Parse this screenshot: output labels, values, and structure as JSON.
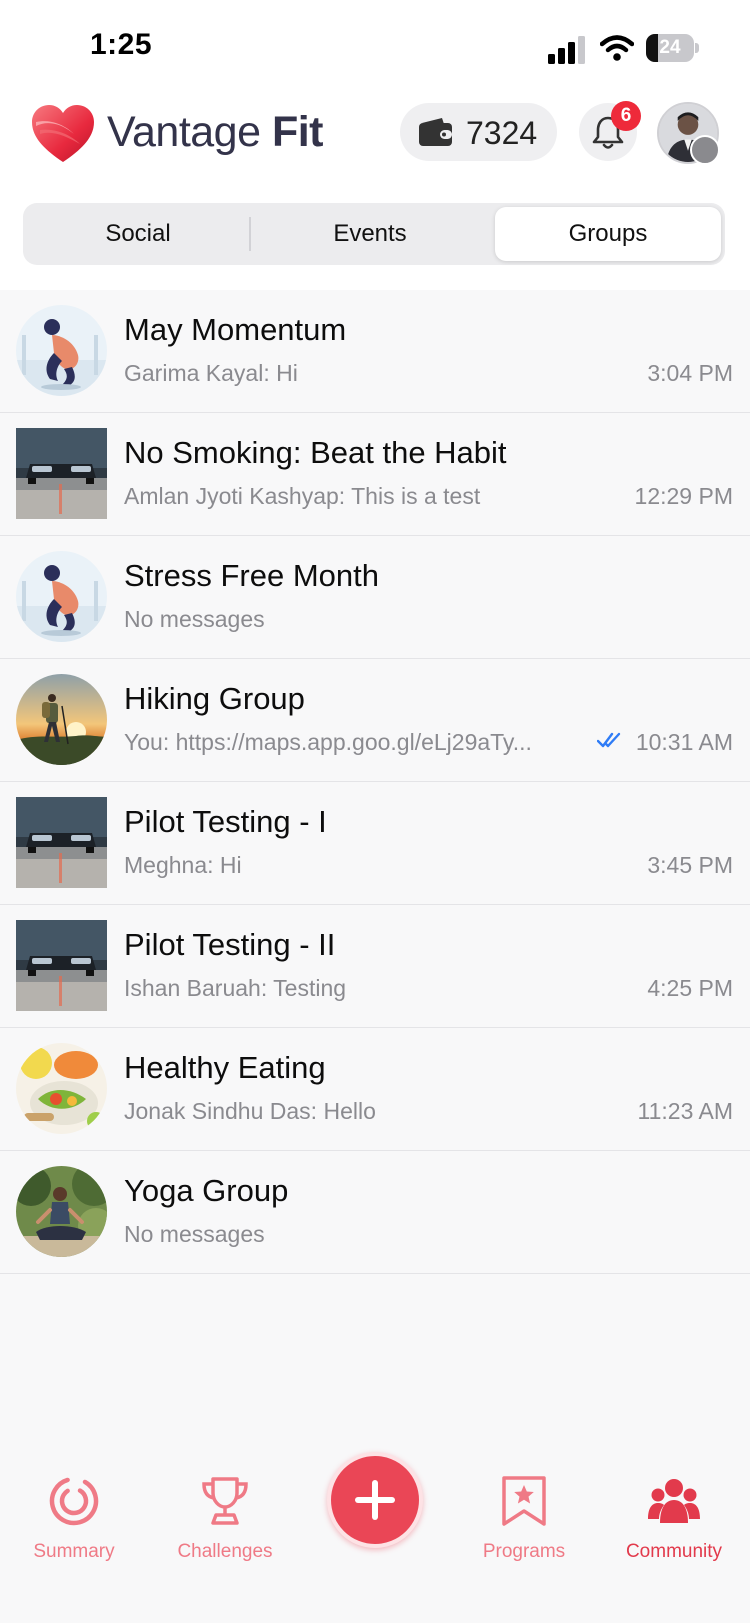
{
  "status_bar": {
    "time": "1:25",
    "battery": "24",
    "battery_level": 0.24
  },
  "header": {
    "brand_regular": "Vantage ",
    "brand_bold": "Fit",
    "wallet_points": "7324",
    "notification_count": "6"
  },
  "tabs": {
    "social": "Social",
    "events": "Events",
    "groups": "Groups",
    "selected": "Groups"
  },
  "groups": [
    {
      "title": "May Momentum",
      "last_message": "Garima Kayal: Hi",
      "time": "3:04 PM",
      "image": "runner-stretch",
      "read_receipt": false
    },
    {
      "title": "No Smoking: Beat the Habit",
      "last_message": "Amlan Jyoti Kashyap: This is a test",
      "time": "12:29 PM",
      "image": "car-tail",
      "read_receipt": false
    },
    {
      "title": "Stress Free Month",
      "last_message": "No messages",
      "time": "",
      "image": "runner-stretch",
      "read_receipt": false
    },
    {
      "title": "Hiking Group",
      "last_message": "You: https://maps.app.goo.gl/eLj29aTy...",
      "time": "10:31 AM",
      "image": "hiker-sunset",
      "read_receipt": true
    },
    {
      "title": "Pilot Testing - I",
      "last_message": "Meghna: Hi",
      "time": "3:45 PM",
      "image": "car-tail",
      "read_receipt": false
    },
    {
      "title": "Pilot Testing - II",
      "last_message": "Ishan Baruah: Testing",
      "time": "4:25 PM",
      "image": "car-tail",
      "read_receipt": false
    },
    {
      "title": "Healthy Eating",
      "last_message": "Jonak Sindhu Das: Hello",
      "time": "11:23 AM",
      "image": "healthy-food",
      "read_receipt": false
    },
    {
      "title": "Yoga Group",
      "last_message": "No messages",
      "time": "",
      "image": "yoga-pose",
      "read_receipt": false
    }
  ],
  "bottom_nav": {
    "summary": "Summary",
    "challenges": "Challenges",
    "programs": "Programs",
    "community": "Community",
    "active": "Community"
  },
  "colors": {
    "accent": "#e23a4c",
    "accent_light": "#ef7a86",
    "badge": "#ee2a3a",
    "brand_text": "#33334a",
    "read_receipt": "#2f7cf6"
  }
}
